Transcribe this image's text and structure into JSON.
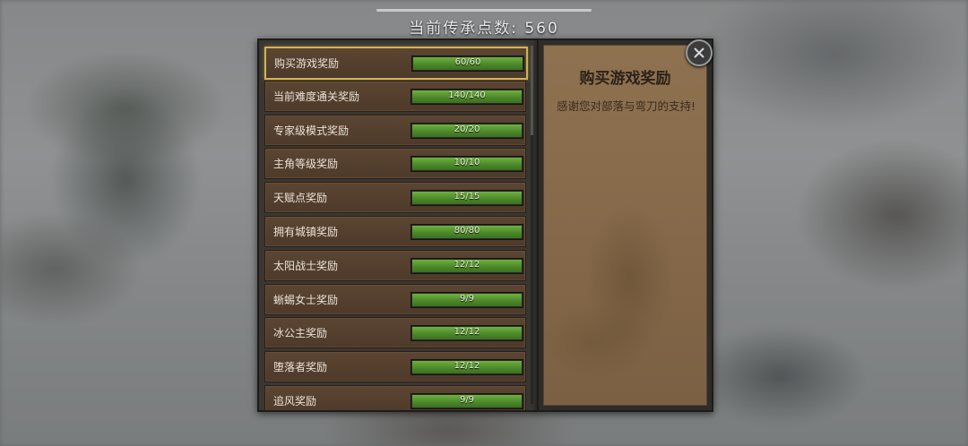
{
  "header": {
    "points_text": "当前传承点数: 560"
  },
  "rewards": [
    {
      "label": "购买游戏奖励",
      "value_text": "60/60",
      "progress": 1.0,
      "selected": true
    },
    {
      "label": "当前难度通关奖励",
      "value_text": "140/140",
      "progress": 1.0
    },
    {
      "label": "专家级模式奖励",
      "value_text": "20/20",
      "progress": 1.0
    },
    {
      "label": "主角等级奖励",
      "value_text": "10/10",
      "progress": 1.0
    },
    {
      "label": "天赋点奖励",
      "value_text": "15/15",
      "progress": 1.0
    },
    {
      "label": "拥有城镇奖励",
      "value_text": "80/80",
      "progress": 1.0
    },
    {
      "label": "太阳战士奖励",
      "value_text": "12/12",
      "progress": 1.0
    },
    {
      "label": "蜥蜴女士奖励",
      "value_text": "9/9",
      "progress": 1.0
    },
    {
      "label": "冰公主奖励",
      "value_text": "12/12",
      "progress": 1.0
    },
    {
      "label": "堕落者奖励",
      "value_text": "12/12",
      "progress": 1.0
    },
    {
      "label": "追风奖励",
      "value_text": "9/9",
      "progress": 1.0
    }
  ],
  "detail": {
    "title": "购买游戏奖励",
    "description": "感谢您对部落与弯刀的支持!"
  },
  "icons": {
    "close": "close-icon"
  },
  "colors": {
    "bar_fill": "#5a9a32",
    "selected_border": "#d2b257",
    "item_bg": "#56402f"
  }
}
